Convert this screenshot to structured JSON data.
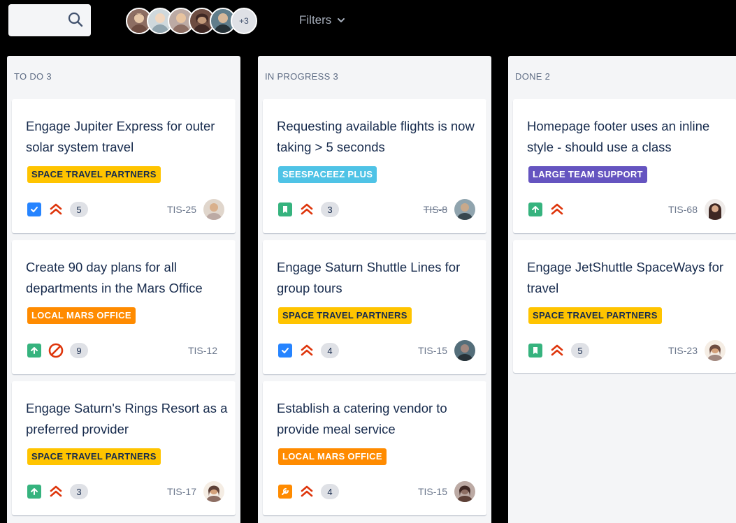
{
  "toolbar": {
    "search_icon": "search-icon",
    "avatars_more": "+3",
    "filters_label": "Filters"
  },
  "columns": [
    {
      "header": "TO DO 3",
      "cards": [
        {
          "title": "Engage Jupiter Express for outer solar system travel",
          "label": "SPACE TRAVEL PARTNERS",
          "label_color": "#ffc400",
          "type": "task",
          "priority": "highest",
          "estimate": "5",
          "key": "TIS-25"
        },
        {
          "title": "Create 90 day plans for all departments in the Mars Office",
          "label": "LOCAL MARS OFFICE",
          "label_color": "#ff8b00",
          "type": "story",
          "priority": "blocker",
          "estimate": "9",
          "key": "TIS-12"
        },
        {
          "title": "Engage Saturn's Rings Resort as a preferred provider",
          "label": "SPACE TRAVEL PARTNERS",
          "label_color": "#ffc400",
          "type": "story",
          "priority": "highest",
          "estimate": "3",
          "key": "TIS-17"
        }
      ]
    },
    {
      "header": "IN PROGRESS 3",
      "cards": [
        {
          "title": "Requesting available flights is now taking > 5 seconds",
          "label": "SEESPACEEZ PLUS",
          "label_color": "#4fc3e6",
          "type": "story",
          "priority": "high",
          "estimate": "3",
          "key": "TIS-8"
        },
        {
          "title": "Engage Saturn Shuttle Lines for group tours",
          "label": "SPACE TRAVEL PARTNERS",
          "label_color": "#ffc400",
          "type": "task",
          "priority": "high",
          "estimate": "4",
          "key": "TIS-15"
        },
        {
          "title": "Establish a catering vendor to provide meal service",
          "label": "LOCAL MARS OFFICE",
          "label_color": "#ff8b00",
          "type": "bug",
          "priority": "high",
          "estimate": "4",
          "key": "TIS-15"
        }
      ]
    },
    {
      "header": "DONE 2",
      "cards": [
        {
          "title": "Homepage footer uses an inline style - should use a class",
          "label": "LARGE TEAM SUPPORT",
          "label_color": "#6554c0",
          "type": "story",
          "priority": "high",
          "estimate": "",
          "key": "TIS-68"
        },
        {
          "title": "Engage JetShuttle SpaceWays for travel",
          "label": "SPACE TRAVEL PARTNERS",
          "label_color": "#ffc400",
          "type": "story",
          "priority": "high",
          "estimate": "5",
          "key": "TIS-23"
        }
      ]
    }
  ]
}
